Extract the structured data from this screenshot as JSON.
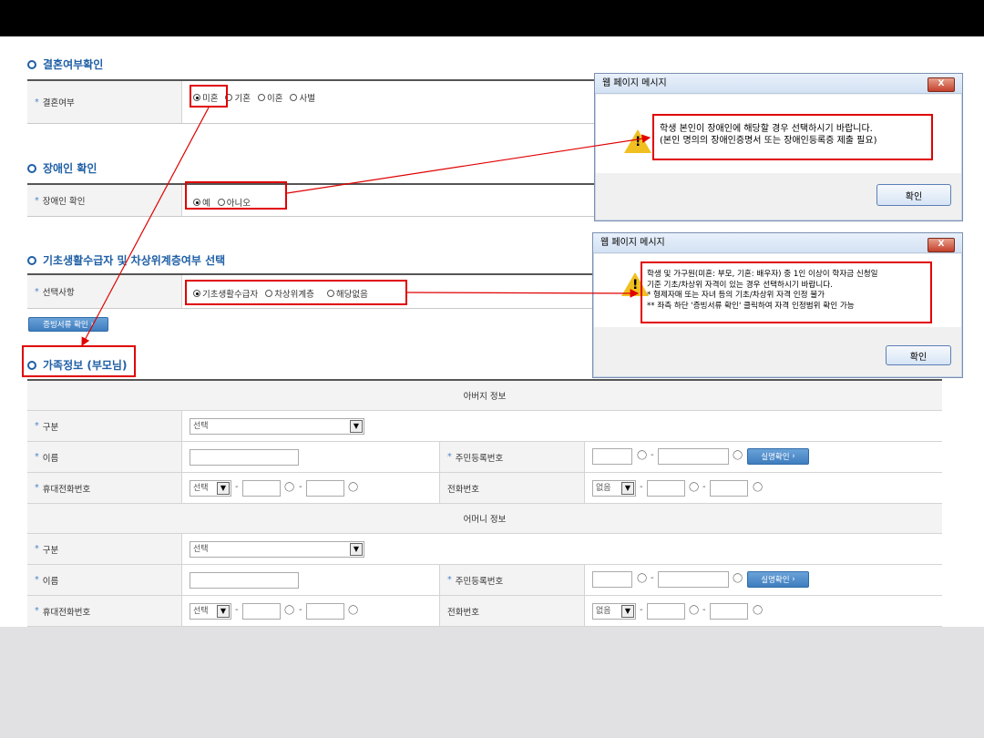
{
  "sections": {
    "marriage": {
      "title": "결혼여부확인",
      "label": "결혼여부",
      "options": [
        "미혼",
        "기혼",
        "이혼",
        "사별"
      ],
      "selected": 0
    },
    "disability": {
      "title": "장애인 확인",
      "label": "장애인 확인",
      "options": [
        "예",
        "아니오"
      ],
      "selected": 0
    },
    "welfare": {
      "title": "기초생활수급자 및 차상위계층여부 선택",
      "label": "선택사항",
      "options": [
        "기초생활수급자",
        "차상위계층",
        "해당없음"
      ],
      "selected": 0
    },
    "proof_button": "증빙서류 확인",
    "family": {
      "title": "가족정보 (부모님)"
    }
  },
  "table": {
    "father_header": "아버지 정보",
    "mother_header": "어머니 정보",
    "labels": {
      "type": "구분",
      "name": "이름",
      "rrn": "주민등록번호",
      "mobile": "휴대전화번호",
      "phone": "전화번호"
    },
    "select_default": "선택",
    "phone_default": "없음",
    "verify_button": "실명확인",
    "dash": "-"
  },
  "dialogs": [
    {
      "title": "웹 페이지 메시지",
      "close": "X",
      "lines": [
        "학생 본인이 장애인에 해당할 경우 선택하시기 바랍니다.",
        "(본인 명의의 장애인증명서 또는 장애인등록증 제출 필요)"
      ],
      "ok": "확인"
    },
    {
      "title": "웹 페이지 메시지",
      "close": "X",
      "lines": [
        "학생 및 가구원(미혼: 부모, 기혼: 배우자) 중 1인 이상이 학자금 신청일",
        "기준 기초/차상위 자격이 있는 경우 선택하시기 바랍니다.",
        "* 형제자매 또는 자녀 등의 기초/차상위 자격 인정 불가",
        "** 좌측 하단 '증빙서류 확인' 클릭하여 자격 인정범위 확인 가능"
      ],
      "ok": "확인"
    }
  ],
  "icons": {
    "warning": "warning-icon",
    "mouse": "mouse-icon",
    "chevron": "chevron-right-icon"
  },
  "colors": {
    "accent": "#1f5fa6",
    "highlight": "#e00000",
    "topbar": "#000000"
  }
}
